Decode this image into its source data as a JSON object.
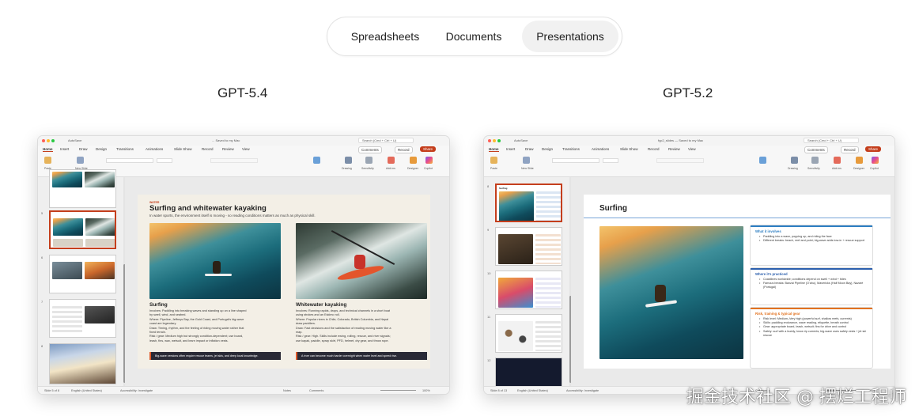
{
  "segmented_control": {
    "options": [
      "Spreadsheets",
      "Documents",
      "Presentations"
    ],
    "selected": "Presentations"
  },
  "panels": [
    {
      "model": "GPT-5.4",
      "app": {
        "autosave": "AutoSave",
        "file_title": "... Saved to my Mac",
        "search": "Search (Cmd + Ctrl + U)",
        "tabs": [
          "Home",
          "Insert",
          "Draw",
          "Design",
          "Transitions",
          "Animations",
          "Slide Show",
          "Record",
          "Review",
          "View"
        ],
        "comments": "Comments",
        "record": "Record",
        "share": "Share",
        "ribbon_labels": [
          "Paste",
          "New Slide",
          "Drawing",
          "Sensitivity",
          "Add-ins",
          "Designer",
          "Copilot"
        ],
        "status_left": "Slide 5 of 8",
        "status_lang": "English (United States)",
        "status_access": "Accessibility: Investigate",
        "status_notes": "Notes",
        "status_comments": "Comments",
        "zoom": "100%"
      },
      "thumb_numbers": [
        "5",
        "6",
        "7",
        "8"
      ],
      "slide": {
        "kicker": "WATER",
        "title": "Surfing and whitewater kayaking",
        "subtitle": "In water sports, the environment itself is moving - so reading conditions matters as much as physical skill.",
        "left": {
          "heading": "Surfing",
          "lines": [
            "Involves: Paddling into breaking waves and standing up on a line shaped",
            "by swell, wind, and seabed.",
            "Where: Pipeline, Jeffreys Bay, the Gold Coast, and Portugal's big-wave",
            "coast are legendary.",
            "Draw: Timing, rhythm, and the feeling of riding moving water rather that",
            "fixed terrain.",
            "Risk / gear: Medium high but strongly condition-dependent; use board,",
            "leash, fins, wax, wetsuit, and learn impact or inflation vests."
          ],
          "callout": "Big-wave versions often require rescue teams, jet skis, and deep local knowledge."
        },
        "right": {
          "heading": "Whitewater kayaking",
          "lines": [
            "Involves: Running rapids, drops, and technical channels in a short boat",
            "using strokes and an Eskimo roll.",
            "Where: Popular rivers in Chile, Colorado, British Columbia, and Nepal",
            "draw paddlers.",
            "Draw: Fast decisions and the satisfaction of reading moving water like a",
            "map.",
            "Risk / gear: High. Skills include ewing, rolling, rescue, and river signals;",
            "use kayak, paddle, spray skirt, PFD, helmet, dry gear, and throw rope."
          ],
          "callout": "A river can become much harder overnight when water level and speed rise."
        }
      }
    },
    {
      "model": "GPT-5.2",
      "app": {
        "autosave": "AutoSave",
        "file_title": "fyp2_slides — Saved to my Mac",
        "search": "Search (Cmd + Ctrl + U)",
        "tabs": [
          "Home",
          "Insert",
          "Draw",
          "Design",
          "Transitions",
          "Animations",
          "Slide Show",
          "Record",
          "Review",
          "View"
        ],
        "comments": "Comments",
        "record": "Record",
        "share": "Share",
        "ribbon_labels": [
          "Paste",
          "New Slide",
          "Drawing",
          "Sensitivity",
          "Add-ins",
          "Designer",
          "Copilot"
        ],
        "status_left": "Slide 8 of 13",
        "status_lang": "English (United States)",
        "status_access": "Accessibility: Investigate",
        "status_notes": "Notes",
        "status_comments": "Comments",
        "zoom": "100%"
      },
      "thumb_numbers": [
        "8",
        "9",
        "10",
        "11",
        "12"
      ],
      "slide": {
        "title": "Surfing",
        "cards": [
          {
            "heading": "What it involves",
            "color": "#2d7ec2",
            "items": [
              "Paddling into a wave, popping up, and riding the face",
              "Different breaks: beach, reef and point; big-wave adds tow-in + rescue support"
            ]
          },
          {
            "heading": "Where it's practiced",
            "color": "#2b5fad",
            "items": [
              "Coastlines worldwide; conditions depend on swell + wind + tides",
              "Famous breaks: Banzai Pipeline (O'ahu), Mavericks (Half Moon Bay), Nazaré (Portugal)"
            ]
          },
          {
            "heading": "Risk, training & typical gear",
            "color": "#e2721f",
            "items": [
              "Risk level: Medium–Very high (powerful surf, shallow reefs, currents)",
              "Skills: paddling endurance, wave reading, etiquette, breath control",
              "Gear: appropriate board, leash, wetsuit; fins for drive and control",
              "Safety: surf with a buddy, know rip currents; big-wave uses safety vests + jet ski rescue"
            ]
          }
        ]
      }
    }
  ],
  "watermark": "掘金技术社区 @ 摆烂工程师"
}
